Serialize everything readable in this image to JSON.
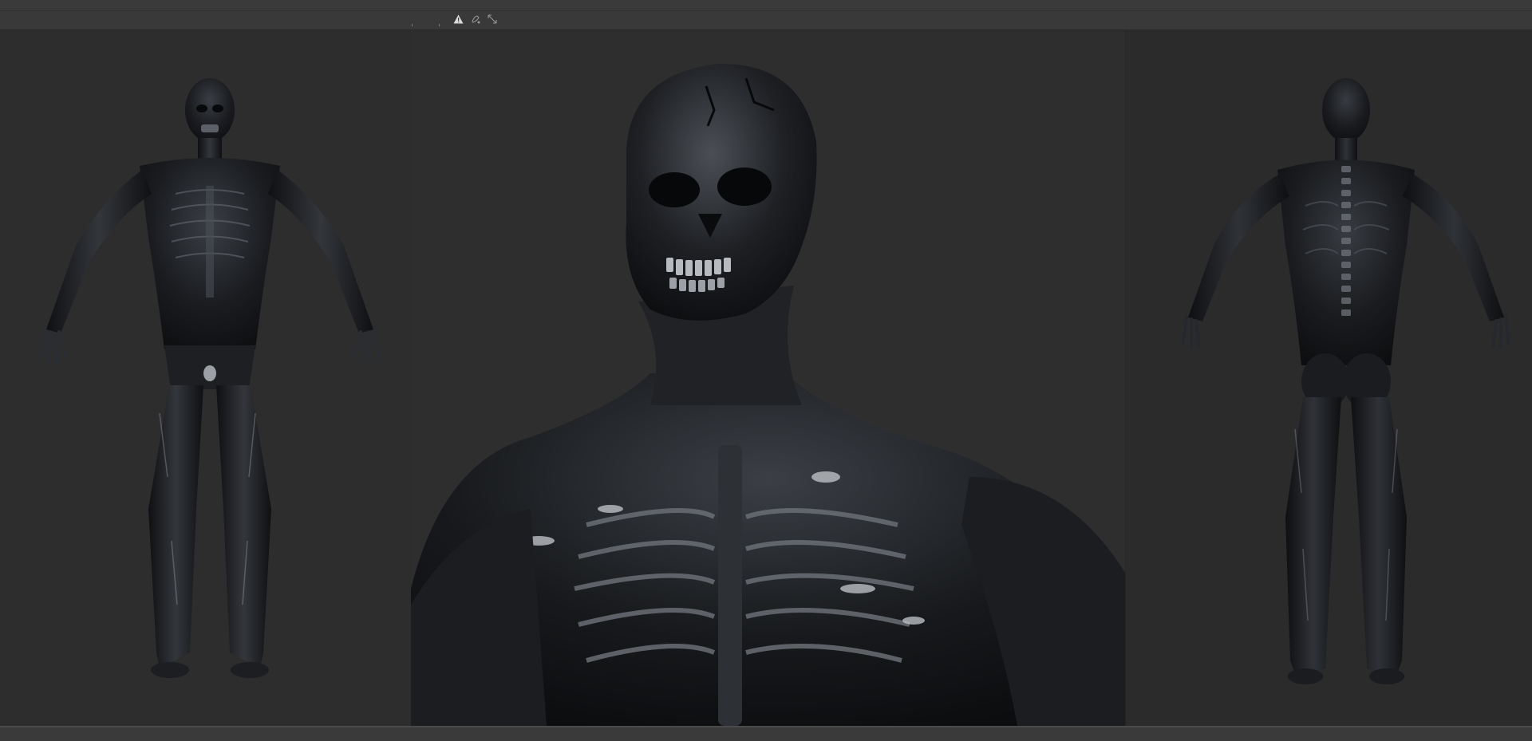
{
  "toolbar": {
    "icons": [
      "warning-icon",
      "brush-icon",
      "resize-icon"
    ]
  },
  "viewports": [
    {
      "view": "front",
      "subject": "creature-full-body-front"
    },
    {
      "view": "closeup",
      "subject": "creature-bust-closeup"
    },
    {
      "view": "back",
      "subject": "creature-full-body-back"
    }
  ],
  "colors": {
    "background": "#2c2c2c",
    "toolbar": "#393939",
    "model_dark": "#141619",
    "model_highlight": "#c8ccd2"
  }
}
